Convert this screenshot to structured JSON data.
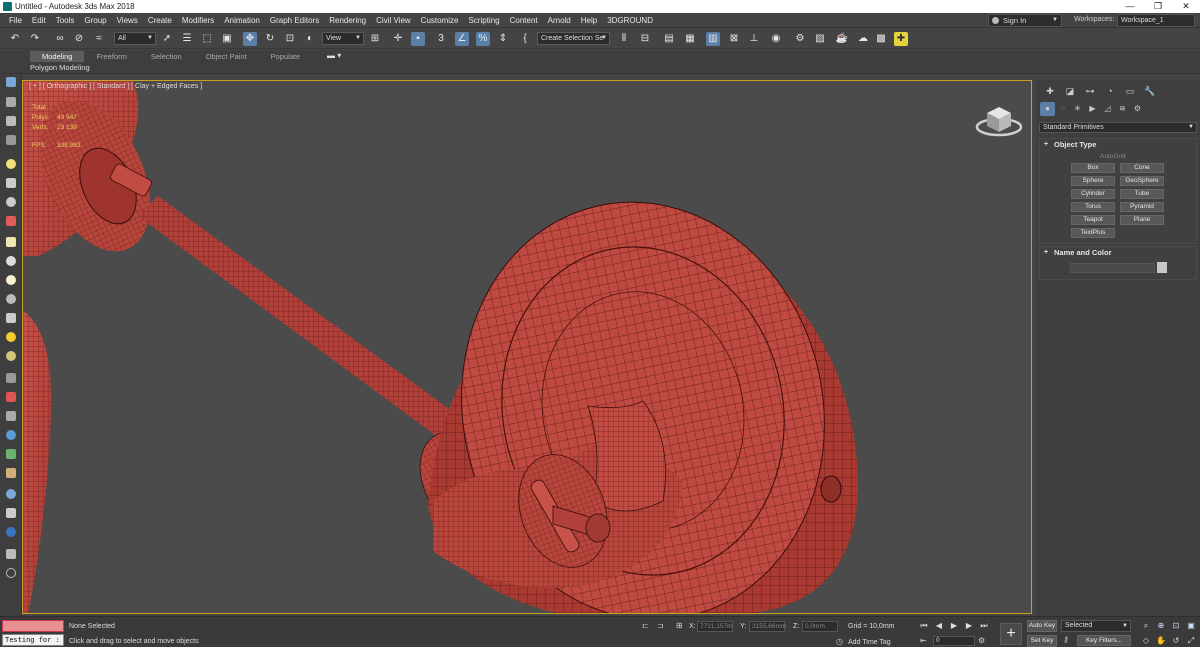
{
  "window": {
    "title": "Untitled - Autodesk 3ds Max 2018",
    "minimize": "—",
    "restore": "❐",
    "close": "✕"
  },
  "menu": [
    "File",
    "Edit",
    "Tools",
    "Group",
    "Views",
    "Create",
    "Modifiers",
    "Animation",
    "Graph Editors",
    "Rendering",
    "Civil View",
    "Customize",
    "Scripting",
    "Content",
    "Arnold",
    "Help",
    "3DGROUND"
  ],
  "account": {
    "sign_in": "Sign In",
    "workspaces_label": "Workspaces:",
    "workspace_value": "Workspace_1"
  },
  "toolbar": {
    "filter_value": "All",
    "ref_coord_value": "View",
    "named_selection_value": "Create Selection Se",
    "snap_label": "3"
  },
  "ribbon": {
    "tabs": [
      "Modeling",
      "Freeform",
      "Selection",
      "Object Paint",
      "Populate"
    ],
    "active_tab": "Modeling",
    "panel_title": "Polygon Modeling"
  },
  "viewport": {
    "label": "[ + ] [ Orthographic ] [ Standard ] [ Clay + Edged Faces ]",
    "stats": {
      "total_label": "Total",
      "polys_label": "Polys:",
      "polys_value": "43 947",
      "verts_label": "Verts:",
      "verts_value": "23 139",
      "fps_label": "FPS:",
      "fps_value": "338,983"
    }
  },
  "command_panel": {
    "dropdown_value": "Standard Primitives",
    "object_type_title": "Object Type",
    "autogrid_label": "AutoGrid",
    "object_buttons": [
      "Box",
      "Cone",
      "Sphere",
      "GeoSphere",
      "Cylinder",
      "Tube",
      "Torus",
      "Pyramid",
      "Teapot",
      "Plane",
      "TextPlus"
    ],
    "name_color_title": "Name and Color"
  },
  "status": {
    "maxscript_value": "Testing for :",
    "selection_status": "None Selected",
    "prompt": "Click and drag to select and move objects",
    "x_label": "X:",
    "x_value": "7721,157m",
    "y_label": "Y:",
    "y_value": "2155,66mm",
    "z_label": "Z:",
    "z_value": "0,0mm",
    "grid": "Grid = 10,0mm",
    "add_time_tag": "Add Time Tag",
    "frame_value": "0",
    "auto_key": "Auto Key",
    "set_key": "Set Key",
    "selected_value": "Selected",
    "key_filters": "Key Filters..."
  },
  "colors": {
    "model_red": "#b8463c",
    "viewport_bg": "#4b4b4b",
    "accent_blue": "#5a7fa8",
    "viewport_border": "#c9a227",
    "stats_yellow": "#f0d060"
  }
}
